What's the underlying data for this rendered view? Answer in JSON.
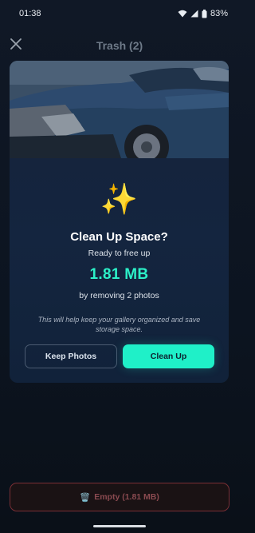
{
  "status_bar": {
    "time": "01:38",
    "battery": "83%",
    "icons": [
      "wifi-icon",
      "signal-icon",
      "battery-icon"
    ]
  },
  "header": {
    "title": "Trash (2)",
    "close_icon": "close-icon"
  },
  "dialog": {
    "icon": "✨",
    "title": "Clean Up Space?",
    "subtitle": "Ready to free up",
    "size": "1.81 MB",
    "removing_text": "by removing 2 photos",
    "note": "This will help keep your gallery organized and save storage space.",
    "keep_label": "Keep Photos",
    "clean_label": "Clean Up"
  },
  "footer": {
    "empty_icon": "🗑️",
    "empty_label": "Empty (1.81 MB)"
  },
  "colors": {
    "accent": "#1ff0c8",
    "size_text": "#2cf0c8",
    "danger_border": "#7a2f35"
  }
}
